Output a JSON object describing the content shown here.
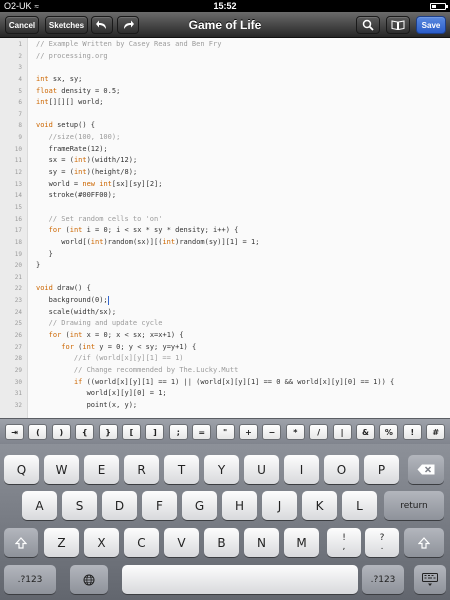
{
  "status": {
    "carrier": "O2-UK",
    "time": "15:52"
  },
  "toolbar": {
    "cancel_label": "Cancel",
    "sketches_label": "Sketches",
    "title": "Game of Life",
    "save_label": "Save",
    "icons": [
      "undo-icon",
      "redo-icon",
      "search-icon",
      "book-icon"
    ]
  },
  "editor": {
    "lines": [
      {
        "n": "1",
        "t": "// Example Written by Casey Reas and Ben Fry"
      },
      {
        "n": "2",
        "t": "// processing.org"
      },
      {
        "n": "3",
        "t": ""
      },
      {
        "n": "4",
        "t": "int sx, sy;"
      },
      {
        "n": "5",
        "t": "float density = 0.5;"
      },
      {
        "n": "6",
        "t": "int[][][] world;"
      },
      {
        "n": "7",
        "t": ""
      },
      {
        "n": "8",
        "t": "void setup() {"
      },
      {
        "n": "9",
        "t": "   //size(100, 100);"
      },
      {
        "n": "10",
        "t": "   frameRate(12);"
      },
      {
        "n": "11",
        "t": "   sx = (int)(width/12);"
      },
      {
        "n": "12",
        "t": "   sy = (int)(height/8);"
      },
      {
        "n": "13",
        "t": "   world = new int[sx][sy][2];"
      },
      {
        "n": "14",
        "t": "   stroke(#00FF00);"
      },
      {
        "n": "15",
        "t": ""
      },
      {
        "n": "16",
        "t": "   // Set random cells to 'on'"
      },
      {
        "n": "17",
        "t": "   for (int i = 0; i < sx * sy * density; i++) {"
      },
      {
        "n": "18",
        "t": "      world[(int)random(sx)][(int)random(sy)][1] = 1;"
      },
      {
        "n": "19",
        "t": "   }"
      },
      {
        "n": "20",
        "t": "}"
      },
      {
        "n": "21",
        "t": ""
      },
      {
        "n": "22",
        "t": "void draw() {"
      },
      {
        "n": "23",
        "t": "   background(0);"
      },
      {
        "n": "24",
        "t": "   scale(width/sx);"
      },
      {
        "n": "25",
        "t": "   // Drawing and update cycle"
      },
      {
        "n": "26",
        "t": "   for (int x = 0; x < sx; x=x+1) {"
      },
      {
        "n": "27",
        "t": "      for (int y = 0; y < sy; y=y+1) {"
      },
      {
        "n": "28",
        "t": "         //if (world[x][y][1] == 1)"
      },
      {
        "n": "29",
        "t": "         // Change recommended by The.Lucky.Mutt"
      },
      {
        "n": "30",
        "t": "         if ((world[x][y][1] == 1) || (world[x][y][1] == 0 && world[x][y][0] == 1)) {"
      },
      {
        "n": "31",
        "t": "            world[x][y][0] = 1;"
      },
      {
        "n": "32",
        "t": "            point(x, y);"
      }
    ]
  },
  "symbols": [
    "⇥",
    "(",
    ")",
    "{",
    "}",
    "[",
    "]",
    ";",
    "=",
    "\"",
    "+",
    "−",
    "*",
    "/",
    "|",
    "&",
    "%",
    "!",
    "#"
  ],
  "keyboard": {
    "row1": [
      "Q",
      "W",
      "E",
      "R",
      "T",
      "Y",
      "U",
      "I",
      "O",
      "P"
    ],
    "row2": [
      "A",
      "S",
      "D",
      "F",
      "G",
      "H",
      "J",
      "K",
      "L"
    ],
    "row3": [
      "Z",
      "X",
      "C",
      "V",
      "B",
      "N",
      "M"
    ],
    "return_label": "return",
    "num_label": ".?123",
    "punct1_top": "!",
    "punct1_bottom": ",",
    "punct2_top": "?",
    "punct2_bottom": "."
  }
}
